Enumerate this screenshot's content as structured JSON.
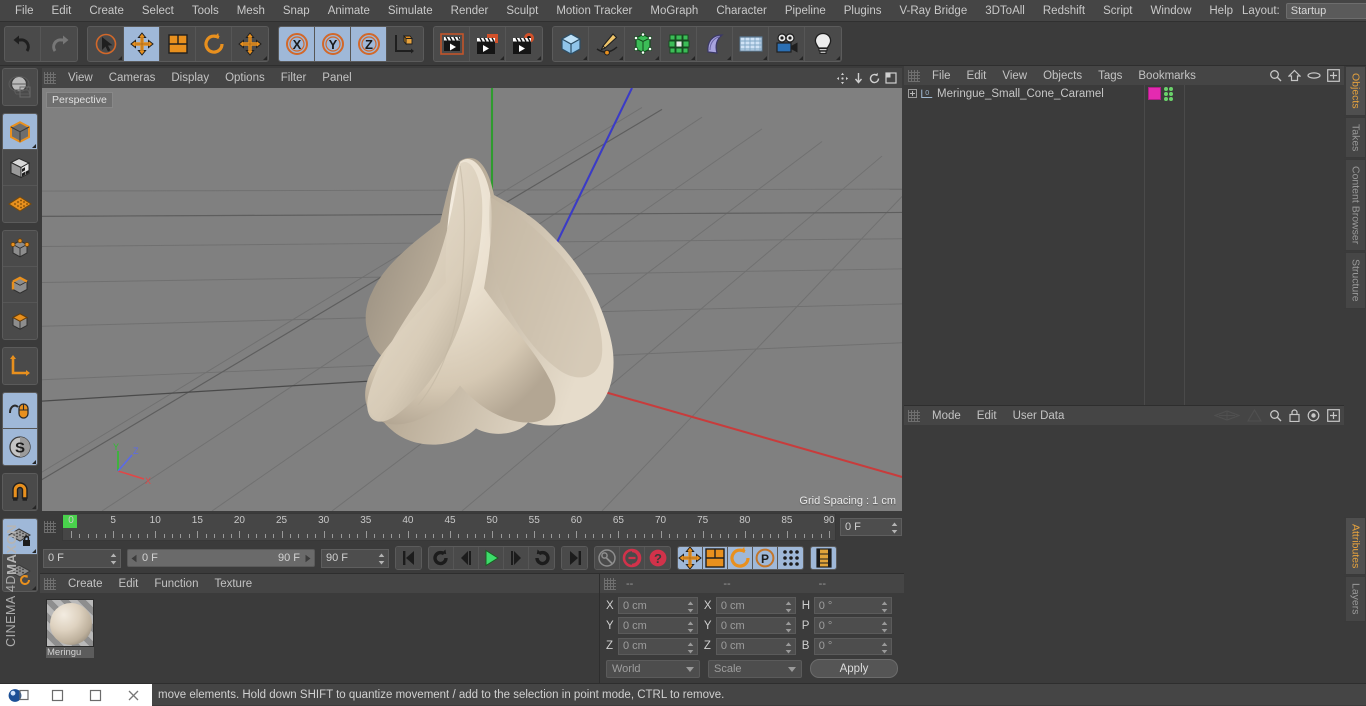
{
  "menubar": {
    "items": [
      "File",
      "Edit",
      "Create",
      "Select",
      "Tools",
      "Mesh",
      "Snap",
      "Animate",
      "Simulate",
      "Render",
      "Sculpt",
      "Motion Tracker",
      "MoGraph",
      "Character",
      "Pipeline",
      "Plugins",
      "V-Ray Bridge",
      "3DToAll",
      "Redshift",
      "Script",
      "Window",
      "Help"
    ],
    "layout_label": "Layout:",
    "layout_value": "Startup",
    "search_icon": "search-icon"
  },
  "toolbar": {
    "groups": [
      {
        "name": "undo-redo",
        "buttons": [
          {
            "name": "undo-button",
            "icon": "undo-arrow-icon",
            "active": false,
            "corner": false
          },
          {
            "name": "redo-button",
            "icon": "redo-arrow-icon",
            "active": false,
            "corner": false
          }
        ]
      },
      {
        "name": "transform-tools",
        "buttons": [
          {
            "name": "live-selection-tool",
            "icon": "cursor-circle-icon",
            "active": false,
            "corner": true
          },
          {
            "name": "move-tool",
            "icon": "move-arrows-icon",
            "active": true,
            "corner": false
          },
          {
            "name": "scale-tool",
            "icon": "scale-box-icon",
            "active": false,
            "corner": false
          },
          {
            "name": "rotate-tool",
            "icon": "rotate-circle-icon",
            "active": false,
            "corner": false
          },
          {
            "name": "free-move-tool",
            "icon": "move-arrows-icon",
            "active": false,
            "corner": true
          }
        ]
      },
      {
        "name": "axis-locks",
        "buttons": [
          {
            "name": "x-axis-lock",
            "icon": "x-axis-icon",
            "active": true,
            "corner": false
          },
          {
            "name": "y-axis-lock",
            "icon": "y-axis-icon",
            "active": true,
            "corner": false
          },
          {
            "name": "z-axis-lock",
            "icon": "z-axis-icon",
            "active": true,
            "corner": false
          },
          {
            "name": "world-object-coordinate-toggle",
            "icon": "world-axis-cube-icon",
            "active": false,
            "corner": false
          }
        ]
      },
      {
        "name": "render-tools",
        "buttons": [
          {
            "name": "render-view-button",
            "icon": "clapboard-frame-icon",
            "active": false,
            "corner": false
          },
          {
            "name": "render-to-picture-viewer-button",
            "icon": "clapboard-window-icon",
            "active": false,
            "corner": true
          },
          {
            "name": "render-settings-button",
            "icon": "clapboard-gear-icon",
            "active": false,
            "corner": true
          }
        ]
      },
      {
        "name": "create-objects",
        "buttons": [
          {
            "name": "add-cube-button",
            "icon": "blue-cube-icon",
            "active": false,
            "corner": true
          },
          {
            "name": "add-spline-button",
            "icon": "pen-spline-icon",
            "active": false,
            "corner": true
          },
          {
            "name": "add-generator-button",
            "icon": "green-cube-cage-icon",
            "active": false,
            "corner": true
          },
          {
            "name": "add-array-button",
            "icon": "green-cluster-icon",
            "active": false,
            "corner": true
          },
          {
            "name": "add-deformer-button",
            "icon": "bend-deformer-icon",
            "active": false,
            "corner": true
          },
          {
            "name": "add-floor-button",
            "icon": "grid-floor-icon",
            "active": false,
            "corner": true
          },
          {
            "name": "add-camera-button",
            "icon": "camera-icon",
            "active": false,
            "corner": true
          },
          {
            "name": "add-light-button",
            "icon": "lightbulb-icon",
            "active": false,
            "corner": true
          }
        ]
      }
    ]
  },
  "leftbar": {
    "groups": [
      {
        "name": "g0",
        "buttons": [
          {
            "name": "make-editable-button",
            "icon": "globe-sphere-icon",
            "active": false,
            "corner": false
          }
        ]
      },
      {
        "name": "g1",
        "buttons": [
          {
            "name": "model-mode-button",
            "icon": "orange-outline-cube-icon",
            "active": true,
            "corner": true
          },
          {
            "name": "texture-mode-button",
            "icon": "checker-cube-icon",
            "active": false,
            "corner": false
          },
          {
            "name": "uv-mesh-mode-button",
            "icon": "orange-grid-plane-icon",
            "active": false,
            "corner": false
          }
        ]
      },
      {
        "name": "g2",
        "buttons": [
          {
            "name": "points-mode-button",
            "icon": "cube-points-icon",
            "active": false,
            "corner": false
          },
          {
            "name": "edges-mode-button",
            "icon": "cube-edges-icon",
            "active": false,
            "corner": false
          },
          {
            "name": "polygons-mode-button",
            "icon": "cube-polygon-icon",
            "active": false,
            "corner": false
          }
        ]
      },
      {
        "name": "g3",
        "buttons": [
          {
            "name": "axis-modify-button",
            "icon": "orange-axis-icon",
            "active": false,
            "corner": false
          }
        ]
      },
      {
        "name": "g4",
        "buttons": [
          {
            "name": "enable-snap-button",
            "icon": "mouse-cursor-icon",
            "active": true,
            "corner": false
          },
          {
            "name": "soft-selection-button",
            "icon": "s-circle-icon",
            "active": true,
            "corner": true
          }
        ]
      },
      {
        "name": "g5",
        "buttons": [
          {
            "name": "magnet-tool-button",
            "icon": "magnet-icon",
            "active": false,
            "corner": true
          }
        ]
      },
      {
        "name": "g6",
        "buttons": [
          {
            "name": "lock-workplane-button",
            "icon": "grid-lock-icon",
            "active": true,
            "corner": true
          },
          {
            "name": "workplane-rotate-button",
            "icon": "grid-rotate-icon",
            "active": false,
            "corner": true
          }
        ]
      }
    ],
    "brand_line1": "MAXON",
    "brand_line2": "CINEMA 4D"
  },
  "viewport": {
    "menu": [
      "View",
      "Cameras",
      "Display",
      "Options",
      "Filter",
      "Panel"
    ],
    "label": "Perspective",
    "grid_spacing": "Grid Spacing : 1 cm",
    "axis_labels": {
      "x": "X",
      "y": "Y",
      "z": "Z"
    },
    "background_color": "#808080",
    "object_color": "#ded2c0"
  },
  "timeline": {
    "ticks": [
      0,
      5,
      10,
      15,
      20,
      25,
      30,
      35,
      40,
      45,
      50,
      55,
      60,
      65,
      70,
      75,
      80,
      85,
      90
    ],
    "current_frame_field": "0 F",
    "start_frame": "0 F",
    "range_left": "0 F",
    "range_right": "90 F",
    "end_frame": "90 F",
    "playhead_frame": 0
  },
  "playback": {
    "buttons": [
      {
        "name": "go-to-start-button",
        "icon": "skip-start-icon",
        "active": false
      },
      {
        "name": "go-to-previous-key-button",
        "icon": "prev-key-icon",
        "active": false
      },
      {
        "name": "step-back-button",
        "icon": "step-back-icon",
        "active": false
      },
      {
        "name": "play-button",
        "icon": "play-icon",
        "active": false
      },
      {
        "name": "step-forward-button",
        "icon": "step-forward-icon",
        "active": false
      },
      {
        "name": "go-to-next-key-button",
        "icon": "next-key-icon",
        "active": false
      },
      {
        "name": "go-to-end-button",
        "icon": "skip-end-icon",
        "active": false
      },
      {
        "name": "record-active-objects-button",
        "icon": "key-icon",
        "active": false
      },
      {
        "name": "autokeying-button",
        "icon": "red-circle-icon",
        "active": false
      },
      {
        "name": "keyframe-selection-button",
        "icon": "red-question-icon",
        "active": false
      },
      {
        "name": "position-key-button",
        "icon": "move-arrows-icon",
        "active": true
      },
      {
        "name": "scale-key-button",
        "icon": "scale-box-icon",
        "active": true
      },
      {
        "name": "rotation-key-button",
        "icon": "rotate-circle-icon",
        "active": true
      },
      {
        "name": "parameter-key-button",
        "icon": "p-circle-icon",
        "active": true
      },
      {
        "name": "point-level-animation-button",
        "icon": "dots-grid-icon",
        "active": true
      },
      {
        "name": "timeline-filmstrip-button",
        "icon": "filmstrip-icon",
        "active": true
      }
    ]
  },
  "material_manager": {
    "menu": [
      "Create",
      "Edit",
      "Function",
      "Texture"
    ],
    "materials": [
      {
        "name": "Meringue",
        "label": "Meringu"
      }
    ]
  },
  "coordinates": {
    "header_dashes": [
      "--",
      "--",
      "--"
    ],
    "rows": [
      {
        "pos_label": "X",
        "pos_value": "0 cm",
        "size_label": "X",
        "size_value": "0 cm",
        "rot_label": "H",
        "rot_value": "0 °"
      },
      {
        "pos_label": "Y",
        "pos_value": "0 cm",
        "size_label": "Y",
        "size_value": "0 cm",
        "rot_label": "P",
        "rot_value": "0 °"
      },
      {
        "pos_label": "Z",
        "pos_value": "0 cm",
        "size_label": "Z",
        "size_value": "0 cm",
        "rot_label": "B",
        "rot_value": "0 °"
      }
    ],
    "system_dropdown": "World",
    "mode_dropdown": "Scale",
    "apply_button": "Apply"
  },
  "object_manager": {
    "menu": [
      "File",
      "Edit",
      "View",
      "Objects",
      "Tags",
      "Bookmarks"
    ],
    "icons": [
      "search-icon",
      "home-icon",
      "ellipse-icon",
      "plus-box-icon"
    ],
    "objects": [
      {
        "name": "Meringue_Small_Cone_Caramel",
        "layer_badge": "0",
        "material_color": "#e42ab0"
      }
    ]
  },
  "attributes": {
    "menu": [
      "Mode",
      "Edit",
      "User Data"
    ],
    "icons": [
      "wing-left-icon",
      "wing-right-icon",
      "search-icon",
      "lock-icon",
      "target-icon",
      "plus-box-icon"
    ]
  },
  "side_tabs_top": [
    "Objects",
    "Takes",
    "Content Browser",
    "Structure"
  ],
  "side_tabs_bottom": [
    "Attributes",
    "Layers"
  ],
  "status_bar": {
    "message": "move elements. Hold down SHIFT to quantize movement / add to the selection in point mode, CTRL to remove.",
    "taskbar_icons": [
      "app-icon",
      "restore-icon",
      "minimize-icon",
      "close-icon"
    ]
  },
  "colors": {
    "accent_orange": "#e8a33d",
    "active_blue": "#9fb8d8",
    "panel_bg": "#3b3b3b",
    "header_bg": "#454545",
    "viewport_bg": "#808080",
    "axis_x": "#d04040",
    "axis_y": "#30a030",
    "axis_z": "#4040c8"
  }
}
